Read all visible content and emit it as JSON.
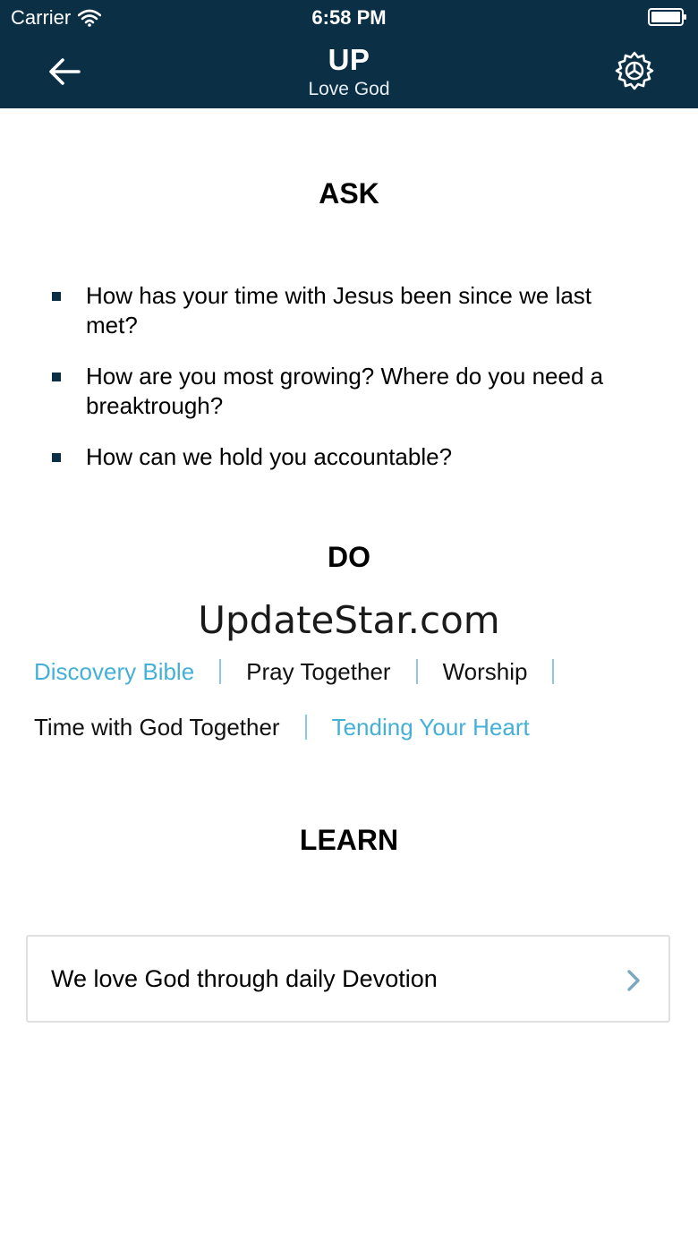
{
  "status_bar": {
    "carrier": "Carrier",
    "time": "6:58 PM"
  },
  "nav": {
    "title": "UP",
    "subtitle": "Love God",
    "back_icon": "back-arrow-icon",
    "settings_icon": "gear-icon",
    "background_color": "#0b2f45"
  },
  "ask": {
    "title": "ASK",
    "items": [
      "How has your time with Jesus been since we last met?",
      "How are you most growing? Where do you need a breaktrough?",
      "How can we hold you accountable?"
    ]
  },
  "do": {
    "title": "DO",
    "watermark": "UpdateStar.com",
    "links": [
      {
        "label": "Discovery Bible",
        "color": "#45b0d6"
      },
      {
        "label": "Pray Together",
        "color": "#111111"
      },
      {
        "label": "Worship",
        "color": "#111111"
      },
      {
        "label": "Time with God Together",
        "color": "#111111"
      },
      {
        "label": "Tending Your Heart",
        "color": "#45b0d6"
      }
    ]
  },
  "learn": {
    "title": "LEARN",
    "card_label": "We love God through daily Devotion",
    "card_icon": "chevron-right-icon"
  }
}
